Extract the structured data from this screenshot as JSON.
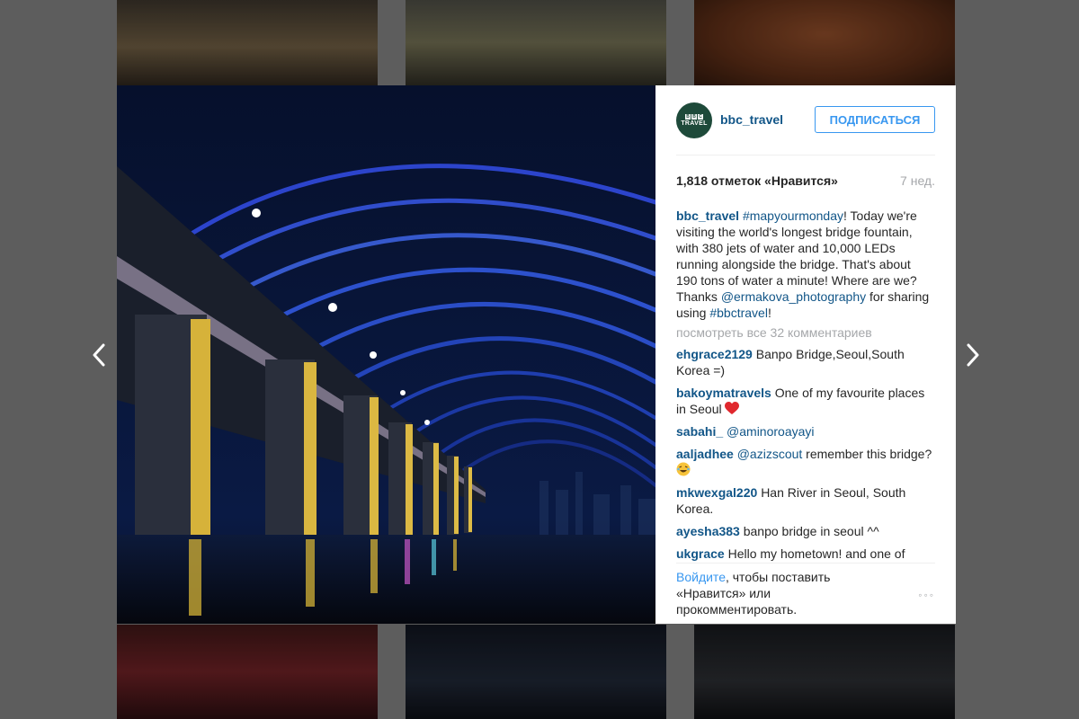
{
  "post": {
    "username": "bbc_travel",
    "follow_label": "ПОДПИСАТЬСЯ",
    "likes": "1,818 отметок «Нравится»",
    "time_ago": "7 нед.",
    "caption": {
      "user": "bbc_travel",
      "hashtag1": "#mapyourmonday",
      "text1": "! Today we're visiting the world's longest bridge fountain, with 380 jets of water and 10,000 LEDs running alongside the bridge. That's about 190 tons of water a minute! Where are we? Thanks ",
      "mention": "@ermakova_photography",
      "text2": " for sharing using ",
      "hashtag2": "#bbctravel",
      "text3": "!"
    },
    "view_all": "посмотреть все 32 комментариев",
    "comments": [
      {
        "user": "ehgrace2129",
        "text": "Banpo Bridge,Seoul,South Korea =)"
      },
      {
        "user": "bakoymatravels",
        "text": "One of my favourite places in Seoul"
      },
      {
        "user": "sabahi_",
        "mention": "@aminoroayayi"
      },
      {
        "user": "aaljadhee",
        "mention": "@azizscout",
        "text": " remember this bridge?"
      },
      {
        "user": "mkwexgal220",
        "text": "Han River in Seoul, South Korea."
      },
      {
        "user": "ayesha383",
        "text": "banpo bridge in seoul ^^"
      },
      {
        "user": "ukgrace",
        "text": "Hello my hometown! and one of"
      }
    ],
    "login_link": "Войдите",
    "login_text": ", чтобы поставить «Нравится» или прокомментировать.",
    "more_dots": "◦◦◦"
  },
  "avatar": {
    "bbc_letters": [
      "B",
      "B",
      "C"
    ],
    "travel": "TRAVEL"
  },
  "icons": {
    "prev": "chevron-left-icon",
    "next": "chevron-right-icon"
  },
  "colors": {
    "link": "#125688",
    "follow": "#3897f0",
    "muted": "#a5a7aa",
    "overlay": "#5d5d5d"
  }
}
